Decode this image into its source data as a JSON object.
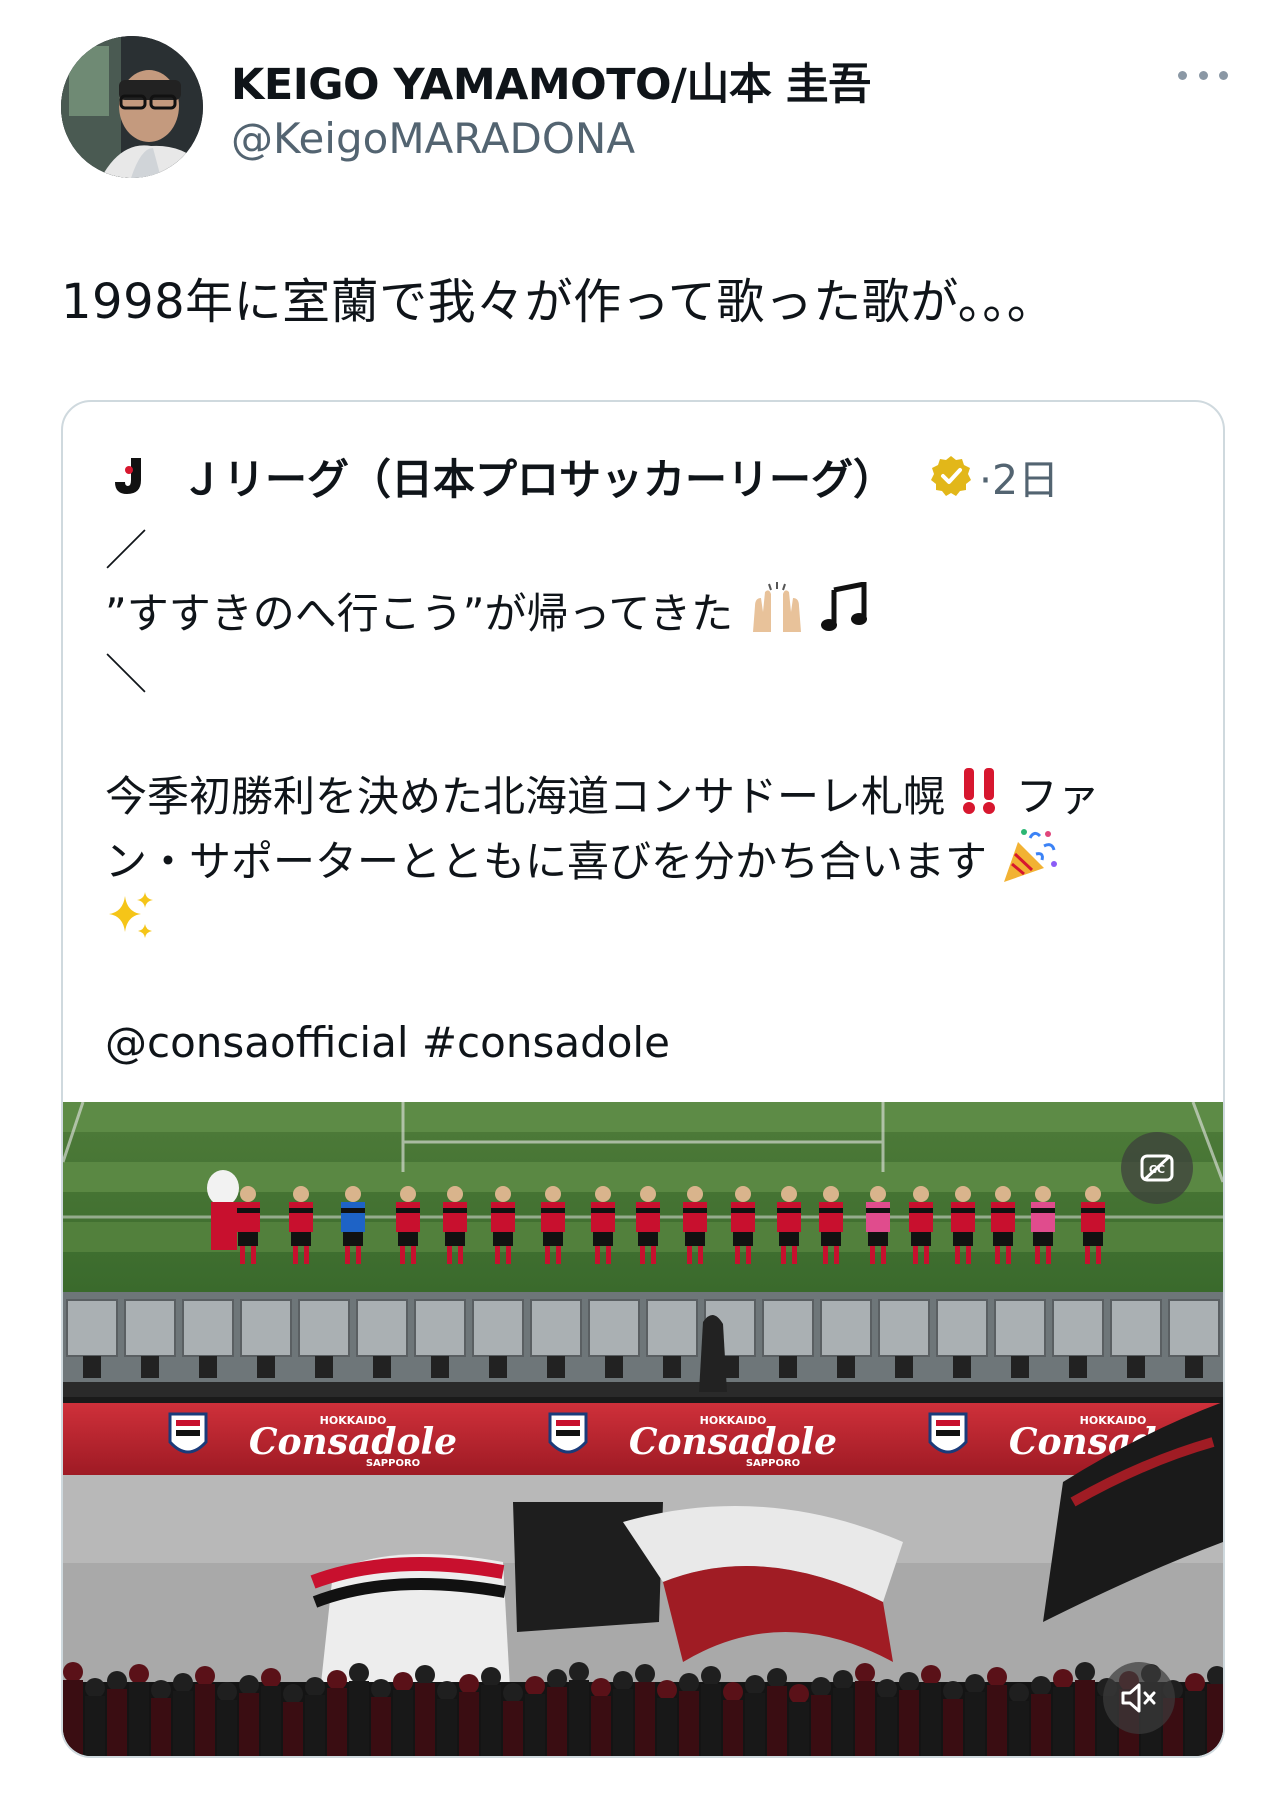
{
  "tweet": {
    "author_name": "KEIGO YAMAMOTO/山本 圭吾",
    "author_handle": "@KeigoMARADONA",
    "text": "1998年に室蘭で我々が作って歌った歌が。。。"
  },
  "quoted": {
    "author_name": "Ｊリーグ（日本プロサッカーリーグ）",
    "time": "·2日",
    "lines": {
      "l1": "／",
      "l2": "”すすきのへ行こう”が帰ってきた",
      "l3": "＼",
      "l4": "今季初勝利を決めた北海道コンサドーレ札幌",
      "l4b": "ファ",
      "l5": "ン・サポーターとともに喜びを分かち合います",
      "l7": "@consaofficial #consadole"
    },
    "media": {
      "banner_text": "Consadole",
      "banner_sub_top": "HOKKAIDO",
      "banner_sub_bottom": "SAPPORO"
    }
  },
  "icons": {
    "more": "more-icon",
    "verified": "verified-gold-badge-icon",
    "captions": "captions-icon",
    "mute": "mute-icon"
  },
  "colors": {
    "text": "#0f1419",
    "secondary": "#536471",
    "border": "#cfd9de",
    "verified_gold": "#e2b719",
    "club_red": "#c8102e"
  }
}
